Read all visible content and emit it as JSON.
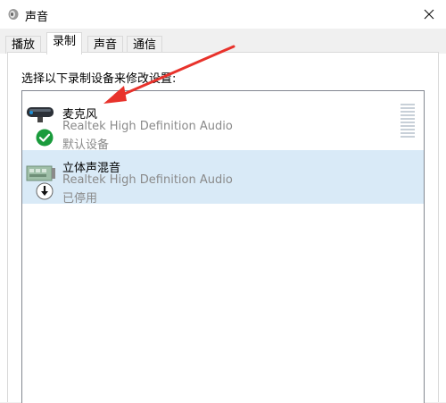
{
  "window": {
    "title": "声音",
    "close_icon": "close-icon"
  },
  "tabs": [
    {
      "label": "播放",
      "active": false
    },
    {
      "label": "录制",
      "active": true
    },
    {
      "label": "声音",
      "active": false
    },
    {
      "label": "通信",
      "active": false
    }
  ],
  "panel": {
    "instruction": "选择以下录制设备来修改设置:"
  },
  "devices": [
    {
      "name": "麦克风",
      "driver": "Realtek High Definition Audio",
      "status": "默认设备",
      "icon": "microphone-icon",
      "badge": "default-check-icon",
      "selected": false
    },
    {
      "name": "立体声混音",
      "driver": "Realtek High Definition Audio",
      "status": "已停用",
      "icon": "sound-card-icon",
      "badge": "disabled-arrow-icon",
      "selected": true
    }
  ],
  "colors": {
    "selection": "#d9eaf7",
    "annotation_arrow": "#e8322b",
    "check_badge": "#1a9b3c"
  }
}
